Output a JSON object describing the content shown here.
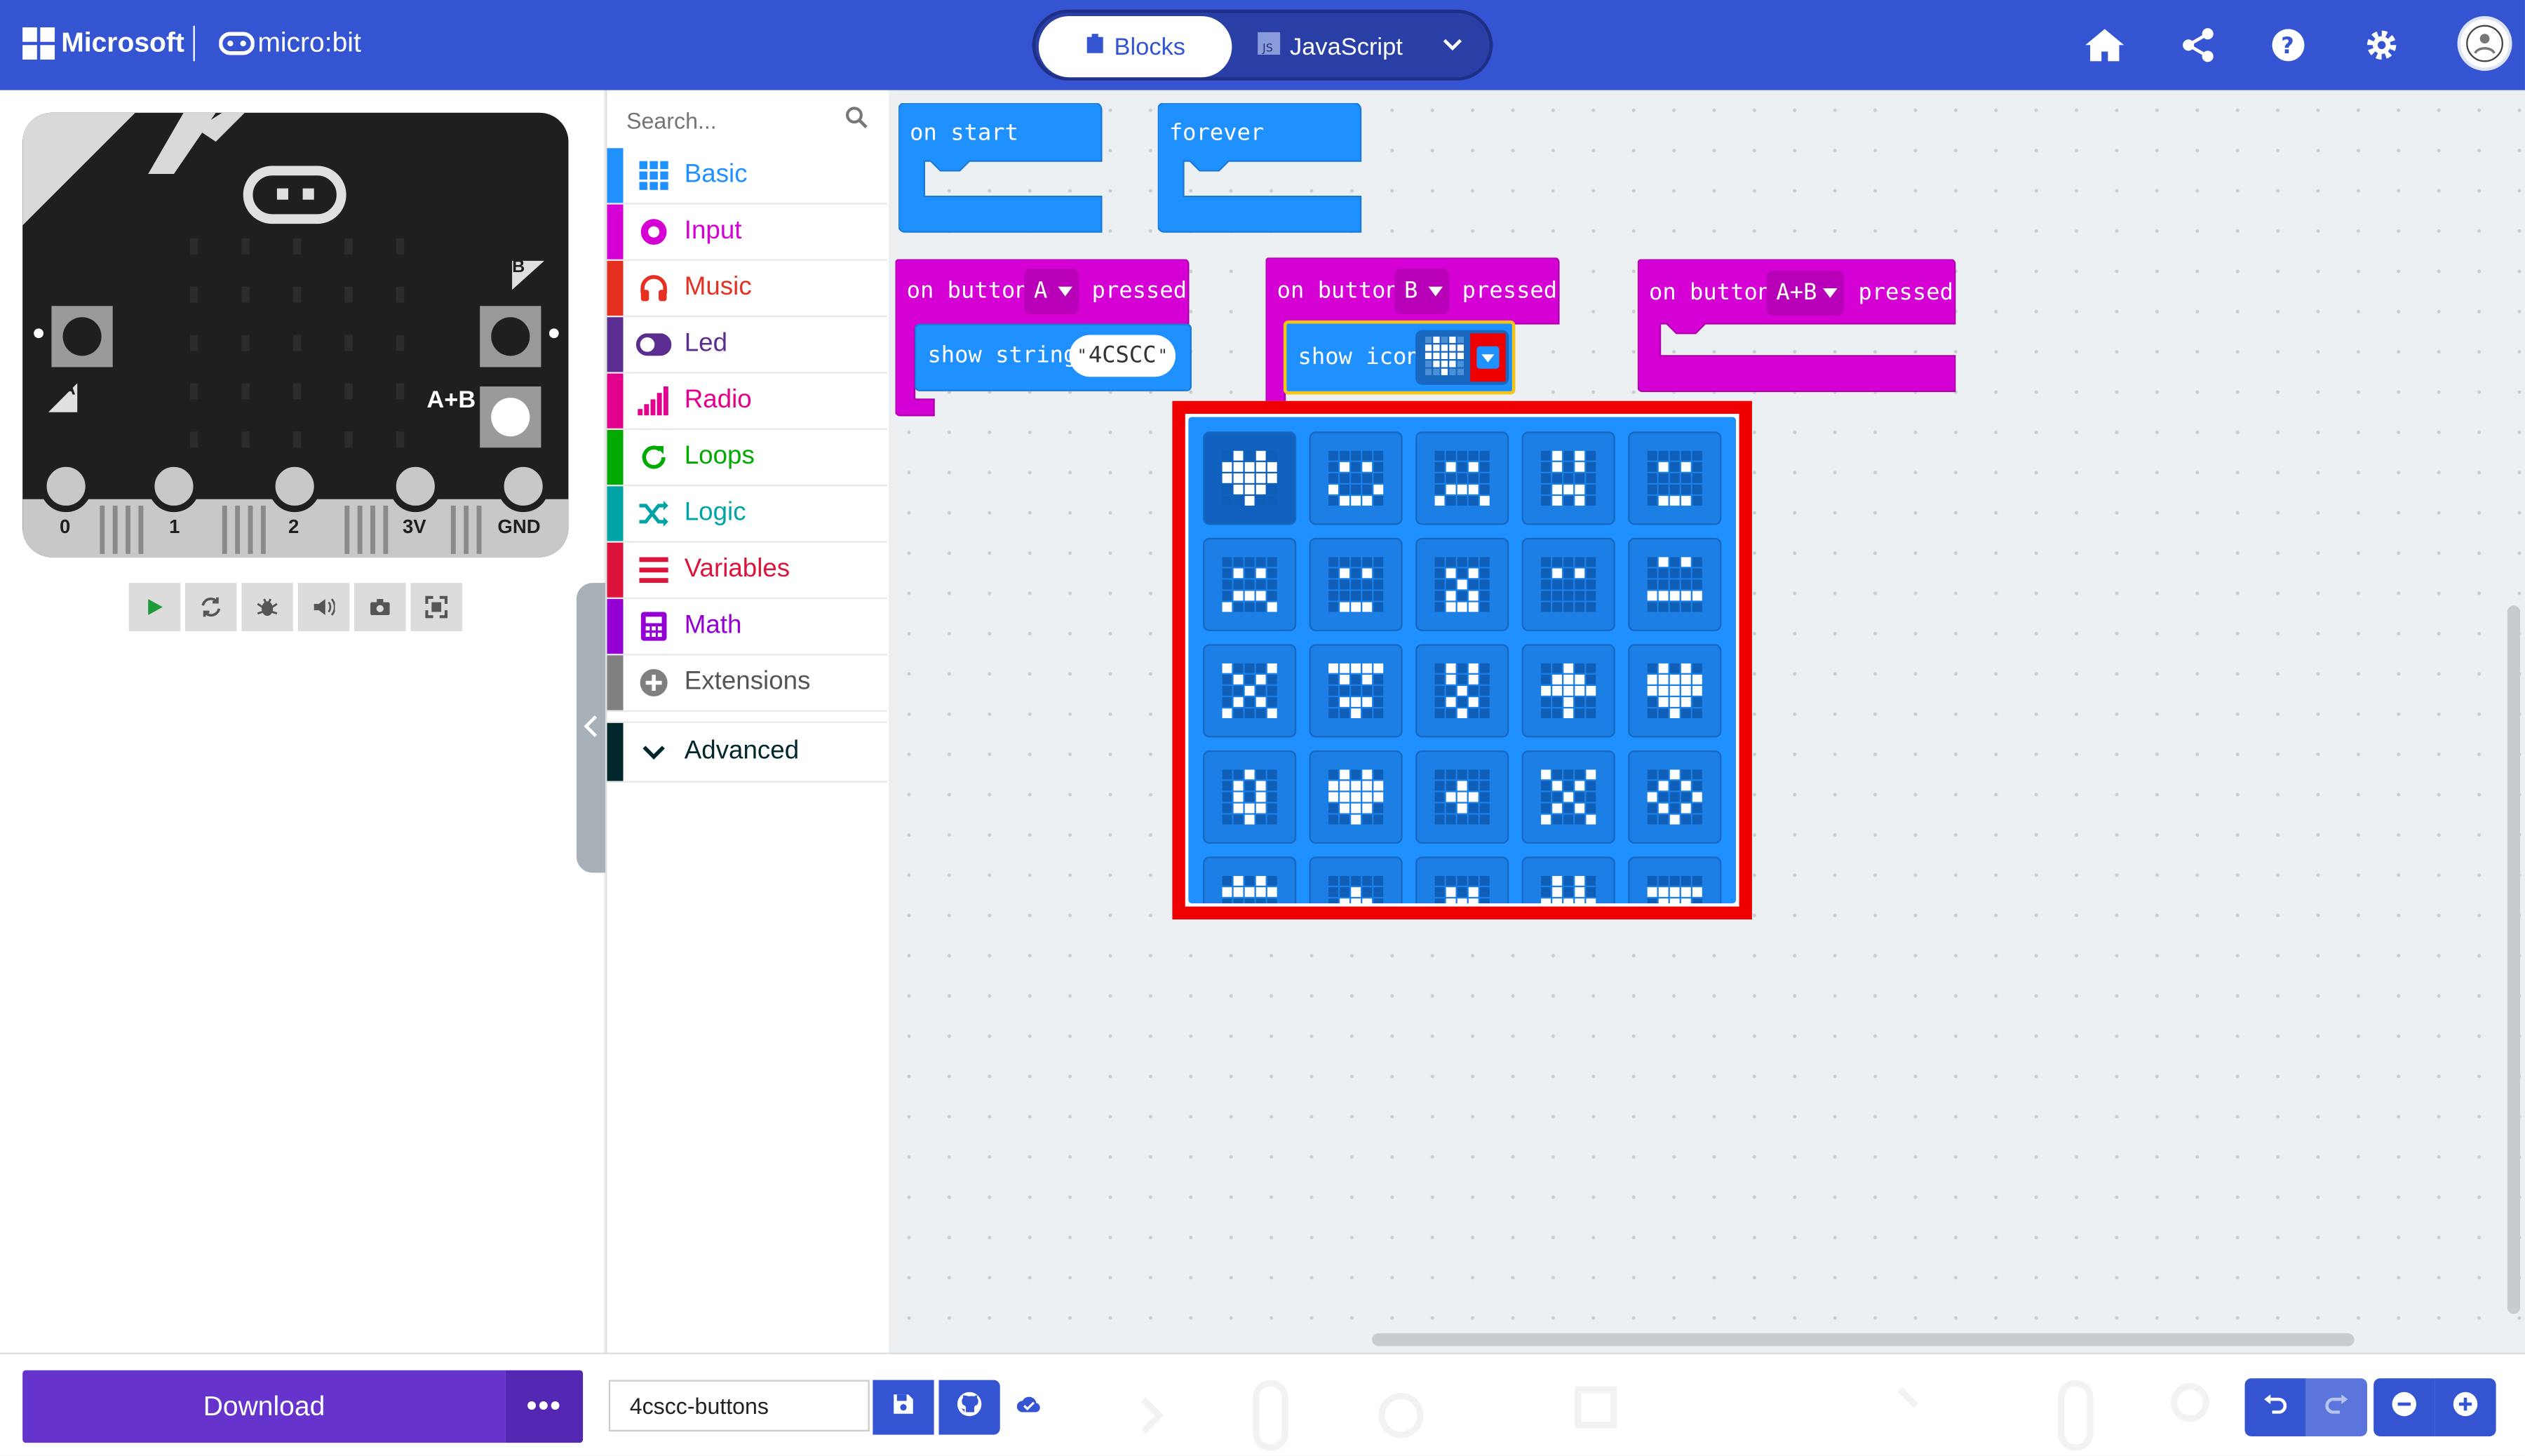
{
  "header": {
    "brand": "Microsoft",
    "product": "micro:bit",
    "tabs": [
      {
        "label": "Blocks",
        "active": true
      },
      {
        "label": "JavaScript",
        "active": false
      }
    ],
    "right_icons": [
      "home-icon",
      "share-icon",
      "help-icon",
      "settings-icon",
      "avatar"
    ]
  },
  "simulator": {
    "button_labels": {
      "a": "A",
      "b": "B",
      "ab": "A+B"
    },
    "pins": [
      "0",
      "1",
      "2",
      "3V",
      "GND"
    ],
    "toolbar": [
      "play-icon",
      "restart-icon",
      "debug-icon",
      "sound-icon",
      "screenshot-icon",
      "fullscreen-icon"
    ]
  },
  "toolbox": {
    "search_placeholder": "Search...",
    "categories": [
      {
        "label": "Basic",
        "color": "#1e90ff"
      },
      {
        "label": "Input",
        "color": "#d400d4"
      },
      {
        "label": "Music",
        "color": "#e63022"
      },
      {
        "label": "Led",
        "color": "#5c2d91"
      },
      {
        "label": "Radio",
        "color": "#e3008c"
      },
      {
        "label": "Loops",
        "color": "#00aa00"
      },
      {
        "label": "Logic",
        "color": "#00a4a6"
      },
      {
        "label": "Variables",
        "color": "#dc143c"
      },
      {
        "label": "Math",
        "color": "#9400d3"
      },
      {
        "label": "Extensions",
        "color": "#7f7f7f"
      },
      {
        "label": "Advanced",
        "color": "#00272b"
      }
    ]
  },
  "workspace": {
    "on_start": "on start",
    "forever": "forever",
    "on_button": "on button",
    "pressed": "pressed",
    "button_a": "A",
    "button_b": "B",
    "button_ab": "A+B",
    "show_string": "show string",
    "string_value": "4CSCC",
    "show_icon": "show icon"
  },
  "footer": {
    "download": "Download",
    "more": "•••",
    "project_name": "4cscc-buttons"
  },
  "colors": {
    "header": "#3454d1",
    "basic_block": "#1e90ff",
    "input_block": "#d400d4",
    "highlight": "#ee0000",
    "download": "#6633cc"
  }
}
